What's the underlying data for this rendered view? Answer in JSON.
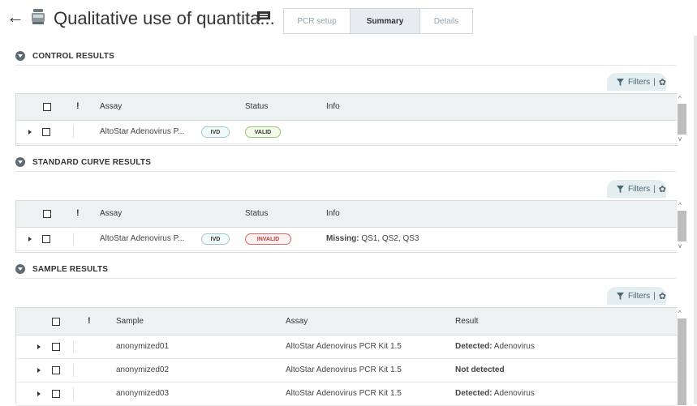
{
  "header": {
    "back_icon": "arrow-left-icon",
    "back_glyph": "←",
    "title": "Qualitative use of quantita...",
    "tabs": [
      {
        "label": "PCR setup"
      },
      {
        "label": "Summary"
      },
      {
        "label": "Details"
      }
    ],
    "active_tab": "Summary"
  },
  "filters": {
    "label": "Filters",
    "separator": "|",
    "gear_glyph": "✿"
  },
  "control": {
    "title": "CONTROL RESULTS",
    "columns": {
      "assay": "Assay",
      "status": "Status",
      "info": "Info",
      "flag": "!"
    },
    "rows": [
      {
        "assay": "AltoStar Adenovirus P...",
        "badge": "IVD",
        "status": "VALID",
        "info_label": "",
        "info_value": ""
      }
    ]
  },
  "standard": {
    "title": "STANDARD CURVE RESULTS",
    "columns": {
      "assay": "Assay",
      "status": "Status",
      "info": "Info",
      "flag": "!"
    },
    "rows": [
      {
        "assay": "AltoStar Adenovirus P...",
        "badge": "IVD",
        "status": "INVALID",
        "info_label": "Missing:",
        "info_value": " QS1, QS2, QS3"
      }
    ]
  },
  "samples": {
    "title": "SAMPLE RESULTS",
    "columns": {
      "sample": "Sample",
      "assay": "Assay",
      "result": "Result",
      "flag": "!"
    },
    "rows": [
      {
        "sample": "anonymized01",
        "assay": "AltoStar Adenovirus PCR Kit 1.5",
        "result_label": "Detected:",
        "result_value": " Adenovirus"
      },
      {
        "sample": "anonymized02",
        "assay": "AltoStar Adenovirus PCR Kit 1.5",
        "result_label": "Not detected",
        "result_value": ""
      },
      {
        "sample": "anonymized03",
        "assay": "AltoStar Adenovirus PCR Kit 1.5",
        "result_label": "Detected:",
        "result_value": " Adenovirus"
      }
    ]
  },
  "colors": {
    "accent_teal": "#e4eef0",
    "valid": "#9bc76a",
    "invalid": "#d96b6b"
  }
}
